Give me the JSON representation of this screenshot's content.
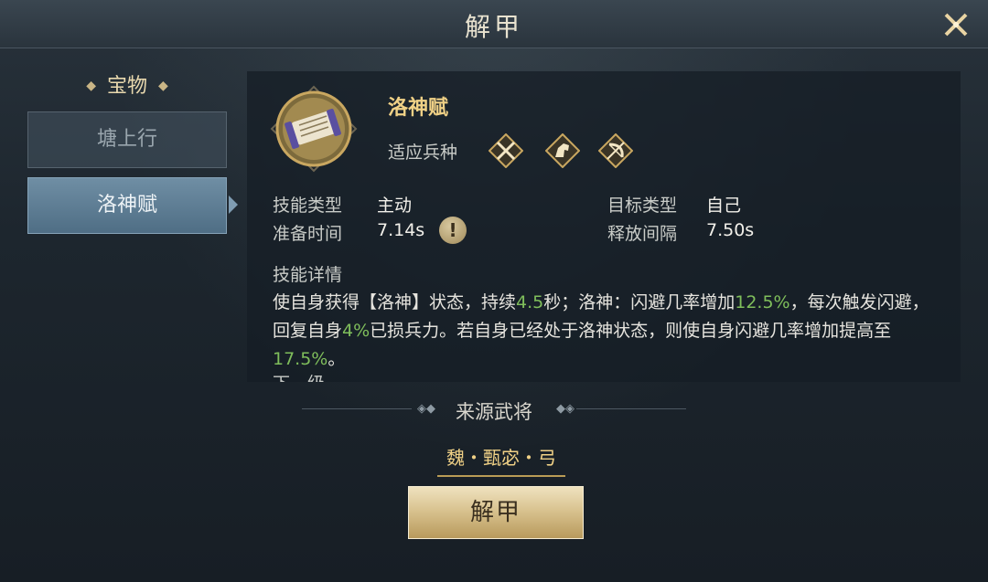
{
  "window": {
    "title": "解甲"
  },
  "sidebar": {
    "heading": "宝物",
    "tabs": [
      {
        "label": "塘上行",
        "selected": false
      },
      {
        "label": "洛神赋",
        "selected": true
      }
    ]
  },
  "skill": {
    "name": "洛神赋",
    "troop_label": "适应兵种",
    "troop_icons": [
      "spear-cross-icon",
      "cavalry-horse-icon",
      "bow-icon"
    ],
    "fields": {
      "skill_type_label": "技能类型",
      "skill_type_value": "主动",
      "target_type_label": "目标类型",
      "target_type_value": "自己",
      "prep_time_label": "准备时间",
      "prep_time_value": "7.14s",
      "release_interval_label": "释放间隔",
      "release_interval_value": "7.50s"
    },
    "info_glyph": "!",
    "detail_label": "技能详情",
    "description": {
      "p1": "使自身获得【洛神】状态，持续",
      "v1": "4.5",
      "p2": "秒；洛神：闪避几率增加",
      "v2": "12.5%",
      "p3": "，每次触发闪避，回复自身",
      "v3": "4%",
      "p4": "已损兵力。若自身已经处于洛神状态，则使自身闪避几率增加提高至",
      "v4": "17.5%",
      "p5": "。"
    },
    "next_level_partial": "下一级"
  },
  "source": {
    "title": "来源武将",
    "general": "魏・甄宓・弓"
  },
  "action": {
    "label": "解甲"
  },
  "colors": {
    "gold": "#f0d186",
    "highlight_green": "#7fbe5b",
    "tab_selected": "#5f7f96"
  }
}
